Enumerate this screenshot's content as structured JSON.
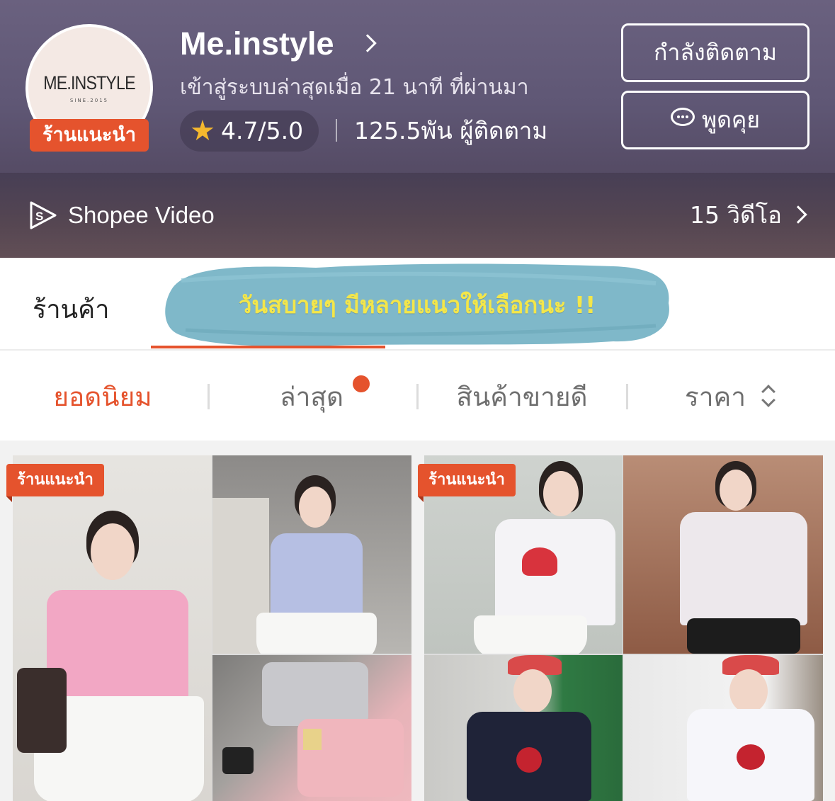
{
  "header": {
    "avatar_logo": "ME.INSTYLE",
    "avatar_logo_sub": "SINE.2015",
    "preferred_badge": "ร้านแนะนำ",
    "shop_name": "Me.instyle",
    "last_seen": "เข้าสู่ระบบล่าสุดเมื่อ 21 นาที ที่ผ่านมา",
    "rating": "4.7/5.0",
    "followers": "125.5พัน ผู้ติดตาม",
    "following_button": "กำลังติดตาม",
    "chat_button": "พูดคุย",
    "video_label": "Shopee Video",
    "video_count": "15 วิดีโอ"
  },
  "tabs": {
    "shop_tab": "ร้านค้า",
    "overlay_caption": "วันสบายๆ มีหลายแนวให้เลือกนะ !!"
  },
  "sort": {
    "popular": "ยอดนิยม",
    "latest": "ล่าสุด",
    "top_sales": "สินค้าขายดี",
    "price": "ราคา"
  },
  "products": [
    {
      "badge": "ร้านแนะนำ"
    },
    {
      "badge": "ร้านแนะนำ"
    }
  ],
  "colors": {
    "accent": "#e5532d",
    "header_bg": "#5f5775",
    "caption_text": "#f3e64a",
    "brush_bg": "#7fb8c9"
  },
  "icons": [
    "chevron-right-icon",
    "star-icon",
    "chat-icon",
    "shopee-video-icon",
    "sort-arrows-icon"
  ]
}
